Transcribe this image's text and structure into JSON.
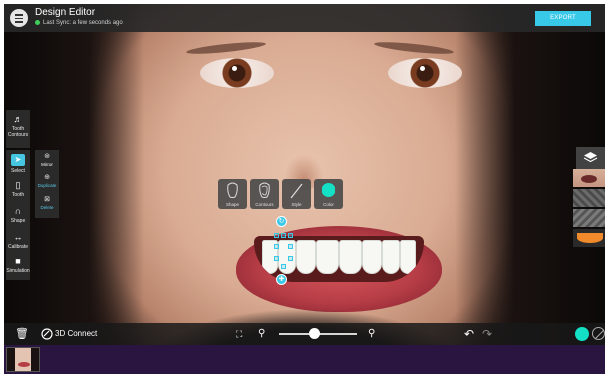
{
  "header": {
    "title": "Design Editor",
    "sync_status": "Last Sync: a few seconds ago",
    "export_label": "EXPORT"
  },
  "left_toolbar": {
    "tooth_contours_label": "Tooth\nContours",
    "tools": [
      {
        "label": "Select",
        "icon": "cursor-icon"
      },
      {
        "label": "Tooth",
        "icon": "tooth-outline-icon"
      },
      {
        "label": "Shape",
        "icon": "shape-curve-icon"
      },
      {
        "label": "Calibrate",
        "icon": "calibrate-arrows-icon"
      },
      {
        "label": "Simulation",
        "icon": "simulation-icon"
      }
    ],
    "sub_tools": [
      {
        "label": "Mirror",
        "icon": "mirror-icon"
      },
      {
        "label": "Duplicate",
        "icon": "duplicate-icon"
      },
      {
        "label": "Delete",
        "icon": "delete-icon"
      }
    ]
  },
  "floating_toolbar": [
    {
      "label": "Shape",
      "icon": "tooth-shape-icon"
    },
    {
      "label": "Contours",
      "icon": "tooth-contour-icon"
    },
    {
      "label": "Style",
      "icon": "style-line-icon"
    },
    {
      "label": "Color",
      "icon": "color-circle-icon"
    }
  ],
  "bottom_toolbar": {
    "connect_label": "3D Connect",
    "zoom_level": 0.45
  },
  "colors": {
    "accent": "#38c8e8",
    "selected_tooth_color": "#13e0c4",
    "sync_dot": "#3ecf5a"
  }
}
